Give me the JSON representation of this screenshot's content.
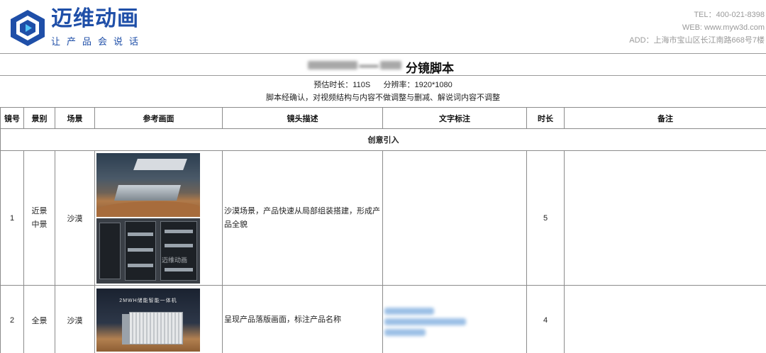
{
  "brand": {
    "name": "迈维动画",
    "slogan": "让产品会说话"
  },
  "contact": {
    "tel": "TEL：400-021-8398",
    "web": "WEB: www.myw3d.com",
    "addr": "ADD：上海市宝山区长江南路668号7楼"
  },
  "doc": {
    "title_suffix": "分镜脚本"
  },
  "info": {
    "line1": "预估时长：110S      分辨率：1920*1080",
    "line2": "脚本经确认，对视频结构与内容不做调整与删减、解说词内容不调整"
  },
  "table": {
    "headers": [
      "镜号",
      "景别",
      "场景",
      "参考画面",
      "镜头描述",
      "文字标注",
      "时长",
      "备注"
    ],
    "section_title": "创意引入",
    "rows": [
      {
        "no": "1",
        "shot_a": "近景",
        "shot_b": "中景",
        "scene": "沙漠",
        "desc": "沙漠场景，产品快速从局部组装搭建，形成产品全貌",
        "annotation": "",
        "duration": "5",
        "note": ""
      },
      {
        "no": "2",
        "shot_a": "全景",
        "shot_b": "",
        "scene": "沙漠",
        "desc": "呈现产品落版画面，标注产品名称",
        "annotation": "",
        "duration": "4",
        "note": ""
      }
    ]
  },
  "images": {
    "row2_caption": "2MWH储能智能一体机",
    "watermark": "迈维动画"
  },
  "colors": {
    "brand_blue": "#1f4fa8",
    "border": "#8c8c8c",
    "muted_text": "#9a9a9a"
  }
}
